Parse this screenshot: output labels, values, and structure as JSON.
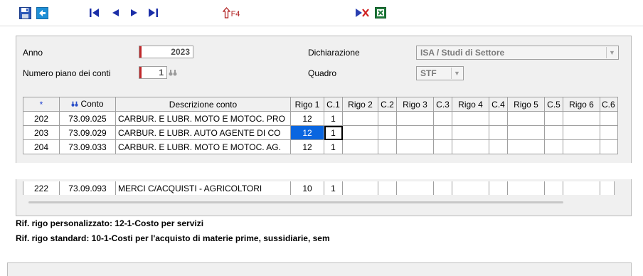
{
  "toolbar": {
    "f4_label": "F4"
  },
  "form": {
    "anno_label": "Anno",
    "anno_value": "2023",
    "piano_label": "Numero piano dei conti",
    "piano_value": "1",
    "dichiarazione_label": "Dichiarazione",
    "dichiarazione_value": "ISA / Studi di Settore",
    "quadro_label": "Quadro",
    "quadro_value": "STF"
  },
  "grid": {
    "headers": {
      "star": "*",
      "conto": "Conto",
      "descrizione": "Descrizione conto",
      "rigo1": "Rigo 1",
      "c1": "C.1",
      "rigo2": "Rigo 2",
      "c2": "C.2",
      "rigo3": "Rigo 3",
      "c3": "C.3",
      "rigo4": "Rigo 4",
      "c4": "C.4",
      "rigo5": "Rigo 5",
      "c5": "C.5",
      "rigo6": "Rigo 6",
      "c6": "C.6"
    },
    "rows": [
      {
        "n": "202",
        "conto": "73.09.025",
        "desc": "CARBUR. E LUBR. MOTO E MOTOC. PRO",
        "rigo1": "12",
        "c1": "1"
      },
      {
        "n": "203",
        "conto": "73.09.029",
        "desc": "CARBUR. E LUBR. AUTO AGENTE DI CO",
        "rigo1": "12",
        "c1": "1"
      },
      {
        "n": "204",
        "conto": "73.09.033",
        "desc": "CARBUR. E LUBR. MOTO E MOTOC. AG.",
        "rigo1": "12",
        "c1": "1"
      },
      {
        "n": "222",
        "conto": "73.09.093",
        "desc": "MERCI C/ACQUISTI - AGRICOLTORI",
        "rigo1": "10",
        "c1": "1"
      }
    ]
  },
  "info": {
    "personalizzato": "Rif. rigo personalizzato: 12-1-Costo per servizi",
    "standard": "Rif. rigo standard: 10-1-Costi per l'acquisto di materie prime, sussidiarie, sem"
  },
  "colors": {
    "selected_cell": "#0a66e0",
    "required_marker": "#c0282a"
  }
}
